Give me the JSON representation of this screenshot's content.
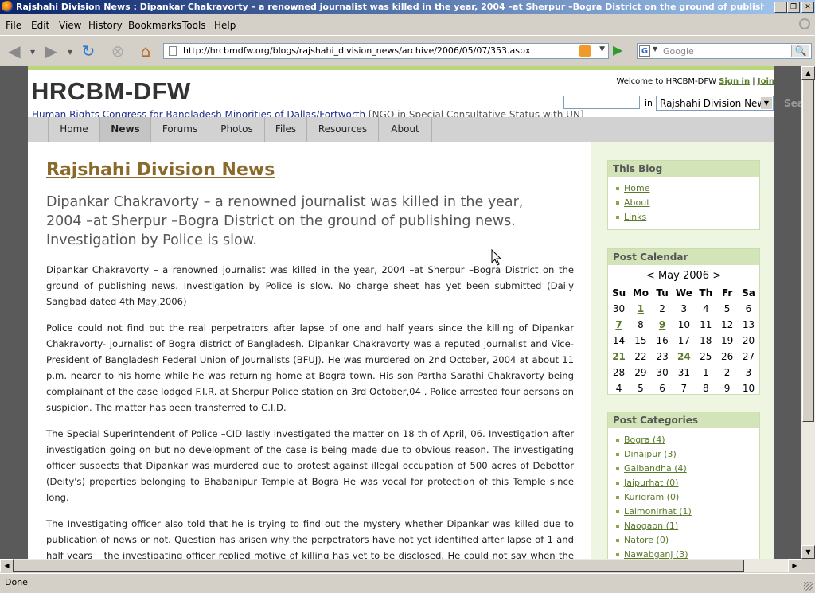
{
  "window": {
    "title": "Rajshahi Division News : Dipankar Chakravorty – a renowned journalist was killed in the year, 2004 –at Sherpur –Bogra District on the ground of publishing news. Inves...",
    "buttons": {
      "minimize": "_",
      "maximize": "❐",
      "close": "✕"
    }
  },
  "menu": [
    "File",
    "Edit",
    "View",
    "History",
    "Bookmarks",
    "Tools",
    "Help"
  ],
  "toolbar": {
    "url": "http://hrcbmdfw.org/blogs/rajshahi_division_news/archive/2006/05/07/353.aspx",
    "search_placeholder": "Google",
    "search_engine": "G"
  },
  "site": {
    "title": "HRCBM-DFW",
    "subtitle": "Human Rights Congress for Bangladesh Minorities of Dallas/Fortworth",
    "ngo_status": "[NGO in Special Consultative Status with UN]",
    "welcome": "Welcome to HRCBM-DFW",
    "sign_in": "Sign in",
    "separator": "|",
    "join": "Join",
    "search_in_label": "in",
    "search_scope": "Rajshahi Division News",
    "search_edge": "Sea",
    "nav": [
      "Home",
      "News",
      "Forums",
      "Photos",
      "Files",
      "Resources",
      "About"
    ],
    "nav_active": "News"
  },
  "post": {
    "blog_title": "Rajshahi Division News",
    "title": "Dipankar Chakravorty – a renowned journalist was killed in the year, 2004 –at Sherpur –Bogra District on the ground of publishing news. Investigation by Police is slow.",
    "paragraphs": [
      "Dipankar Chakravorty – a renowned journalist was killed in the year, 2004 –at Sherpur –Bogra District on the ground of publishing news. Investigation by Police is slow. No charge sheet has yet been submitted (Daily Sangbad dated 4th May,2006)",
      "Police could not find out the real perpetrators after lapse of one and half years since the killing of Dipankar Chakravorty- journalist of Bogra district of Bangladesh.   Dipankar Chakravorty was a reputed journalist and Vice-President of Bangladesh Federal Union of Journalists (BFUJ). He was murdered on 2nd October, 2004 at about 11 p.m. nearer to his home while he was returning home at Bogra town. His son Partha Sarathi Chakravorty being complainant of the case lodged F.I.R. at Sherpur Police station on 3rd October,04 . Police arrested four persons on suspicion. The matter has been transferred to C.I.D.",
      "The Special Superintendent of Police –CID lastly investigated the matter on 18 th of April, 06. Investigation after investigation going on but no development of the case is being made due to obvious reason. The investigating officer suspects that Dipankar was murdered due to protest against illegal occupation of 500 acres of Debottor (Deity's) properties belonging to Bhabanipur Temple at Bogra He was vocal for protection of this Temple since long.",
      "The Investigating officer also told that he is trying to find out the mystery whether Dipankar was killed due to publication of news or not. Question has arisen why the perpetrators have not yet identified after lapse of 1 and half years – the investigating officer replied motive of killing has yet to be disclosed. He could not say when the charge sheet would be submitted."
    ]
  },
  "sidebar": {
    "this_blog": {
      "heading": "This Blog",
      "links": [
        "Home",
        "About",
        "Links"
      ]
    },
    "calendar": {
      "heading": "Post Calendar",
      "prev": "<",
      "month": "May 2006",
      "next": ">",
      "days": [
        "Su",
        "Mo",
        "Tu",
        "We",
        "Th",
        "Fr",
        "Sa"
      ],
      "weeks": [
        [
          "30",
          "1",
          "2",
          "3",
          "4",
          "5",
          "6"
        ],
        [
          "7",
          "8",
          "9",
          "10",
          "11",
          "12",
          "13"
        ],
        [
          "14",
          "15",
          "16",
          "17",
          "18",
          "19",
          "20"
        ],
        [
          "21",
          "22",
          "23",
          "24",
          "25",
          "26",
          "27"
        ],
        [
          "28",
          "29",
          "30",
          "31",
          "1",
          "2",
          "3"
        ],
        [
          "4",
          "5",
          "6",
          "7",
          "8",
          "9",
          "10"
        ]
      ],
      "linked_days": [
        "1",
        "7",
        "9",
        "21",
        "24"
      ]
    },
    "categories": {
      "heading": "Post Categories",
      "items": [
        "Bogra (4)",
        "Dinajpur (3)",
        "Gaibandha (4)",
        "Jaipurhat (0)",
        "Kurigram (0)",
        "Lalmonirhat (1)",
        "Naogaon (1)",
        "Natore (0)",
        "Nawabganj (3)"
      ]
    }
  },
  "status": {
    "text": "Done"
  }
}
